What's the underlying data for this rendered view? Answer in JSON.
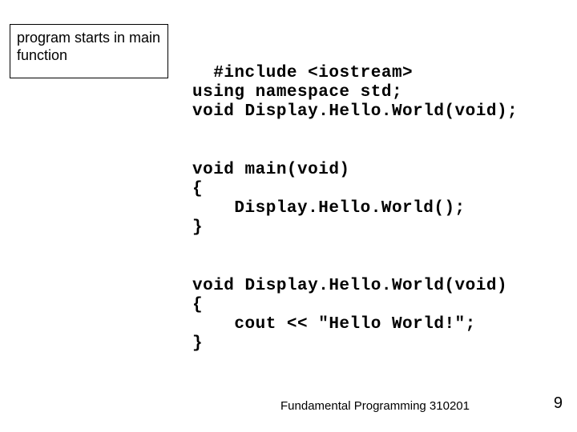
{
  "annotation": {
    "text": "program starts in main function"
  },
  "code": {
    "content": "#include <iostream>\nusing namespace std;\nvoid Display.Hello.World(void);\n\n\nvoid main(void)\n{\n    Display.Hello.World();\n}\n\n\nvoid Display.Hello.World(void)\n{\n    cout << \"Hello World!\";\n}"
  },
  "footer": {
    "text": "Fundamental Programming 310201",
    "page": "9"
  }
}
